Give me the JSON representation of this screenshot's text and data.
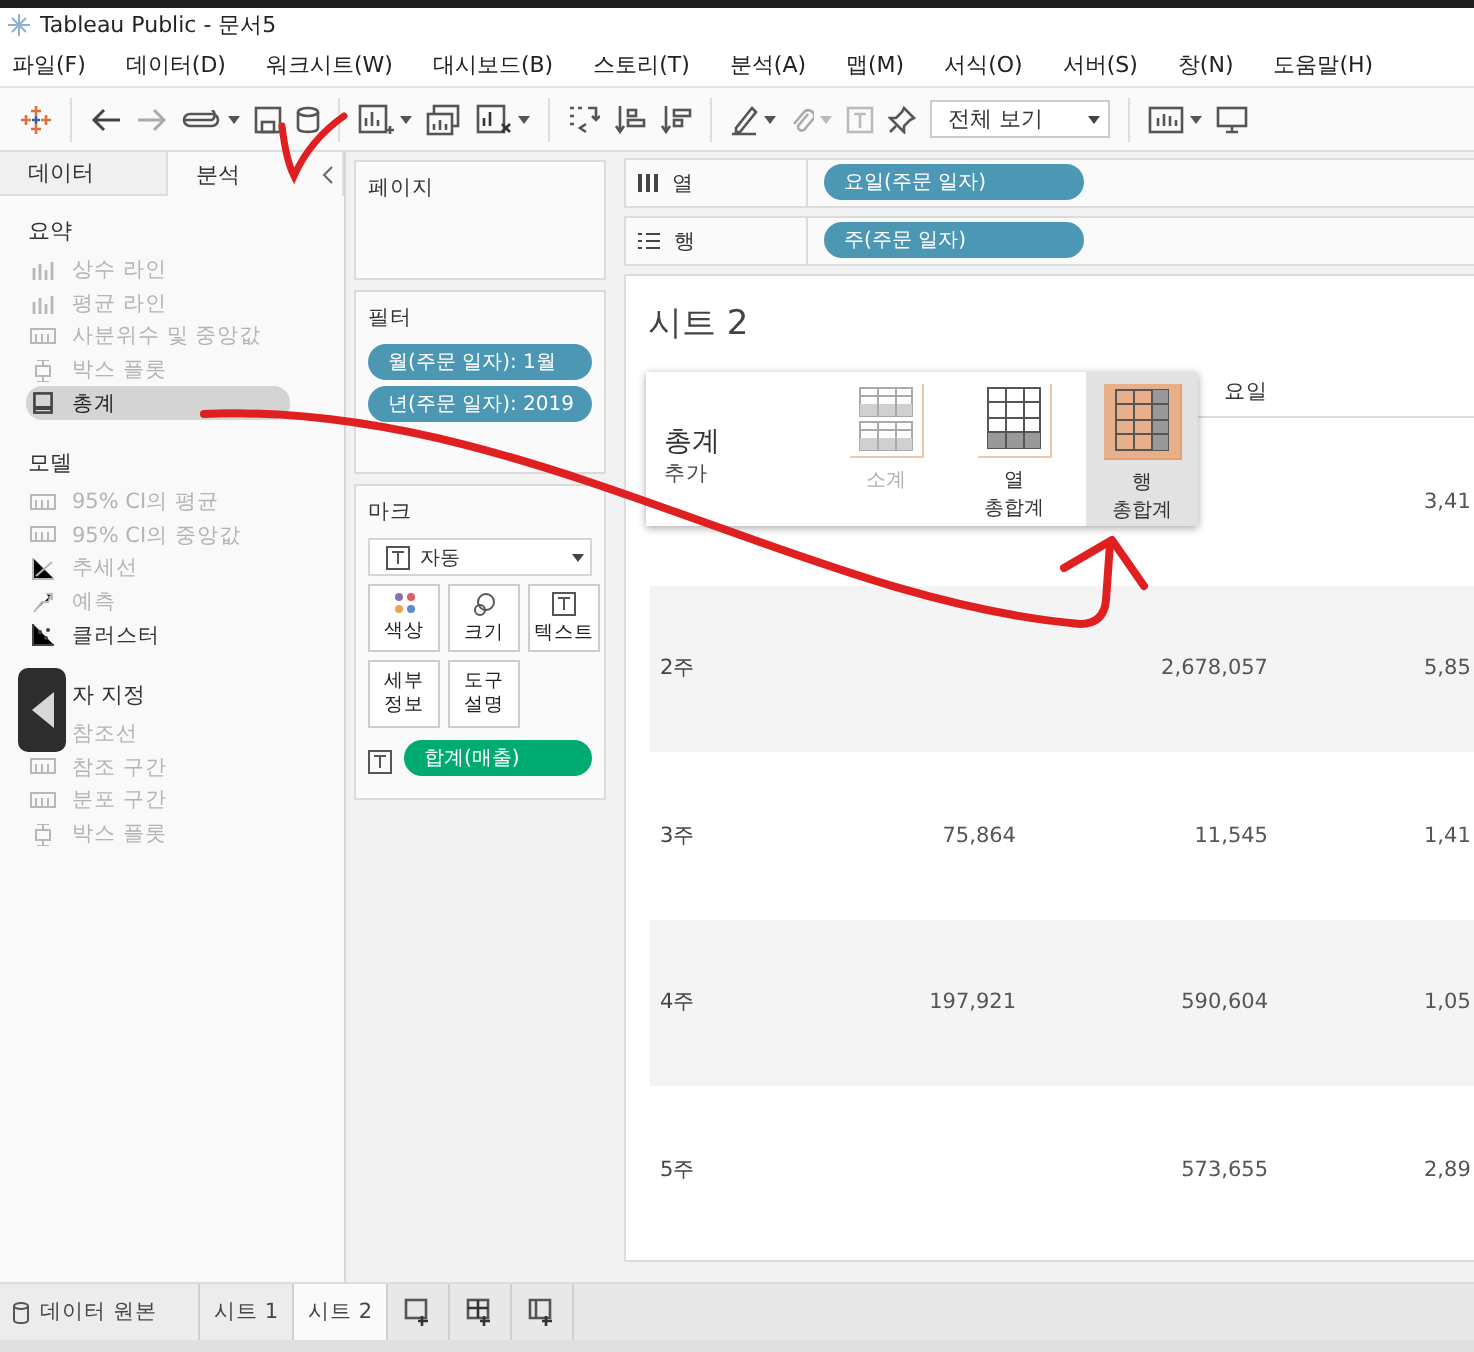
{
  "window": {
    "title": "Tableau Public - 문서5"
  },
  "menu": [
    "파일(F)",
    "데이터(D)",
    "워크시트(W)",
    "대시보드(B)",
    "스토리(T)",
    "분석(A)",
    "맵(M)",
    "서식(O)",
    "서버(S)",
    "창(N)",
    "도움말(H)"
  ],
  "toolbar": {
    "fit_dropdown": "전체 보기"
  },
  "left_pane": {
    "tabs": [
      {
        "label": "데이터",
        "selected": false
      },
      {
        "label": "분석",
        "selected": true
      }
    ],
    "sections": [
      {
        "title": "요약",
        "items": [
          {
            "kind": "bars",
            "label": "상수 라인",
            "disabled": true,
            "selected": false
          },
          {
            "kind": "bars",
            "label": "평균 라인",
            "disabled": true,
            "selected": false
          },
          {
            "kind": "band",
            "label": "사분위수 및 중앙값",
            "disabled": true,
            "selected": false
          },
          {
            "kind": "box",
            "label": "박스 플롯",
            "disabled": true,
            "selected": false
          },
          {
            "kind": "total",
            "label": "총계",
            "disabled": false,
            "selected": true
          }
        ]
      },
      {
        "title": "모델",
        "items": [
          {
            "kind": "band",
            "label": "95% CI의 평균",
            "disabled": true,
            "selected": false
          },
          {
            "kind": "band",
            "label": "95% CI의 중앙값",
            "disabled": true,
            "selected": false
          },
          {
            "kind": "trend",
            "label": "추세선",
            "disabled": true,
            "selected": false
          },
          {
            "kind": "forecast",
            "label": "예측",
            "disabled": true,
            "selected": false
          },
          {
            "kind": "cluster",
            "label": "클러스터",
            "disabled": false,
            "selected": false
          }
        ]
      },
      {
        "title": "자 지정",
        "items": [
          {
            "kind": "hidden",
            "label": "참조선",
            "disabled": true,
            "selected": false
          },
          {
            "kind": "band",
            "label": "참조 구간",
            "disabled": true,
            "selected": false
          },
          {
            "kind": "band",
            "label": "분포 구간",
            "disabled": true,
            "selected": false
          },
          {
            "kind": "box",
            "label": "박스 플롯",
            "disabled": true,
            "selected": false
          }
        ]
      }
    ]
  },
  "cards": {
    "pages": "페이지",
    "filters": {
      "title": "필터",
      "pills": [
        "월(주문 일자): 1월",
        "년(주문 일자): 2019"
      ]
    },
    "marks": {
      "title": "마크",
      "type": "자동",
      "buttons": [
        {
          "kind": "color",
          "label": "색상"
        },
        {
          "kind": "size",
          "label": "크기"
        },
        {
          "kind": "text",
          "label": "텍스트"
        },
        {
          "kind": "plain",
          "label": "세부\n정보"
        },
        {
          "kind": "plain",
          "label": "도구\n설명"
        }
      ],
      "pill": "합계(매출)"
    }
  },
  "shelves": [
    {
      "kind": "columns",
      "label": "열",
      "pill": "요일(주문 일자)"
    },
    {
      "kind": "rows",
      "label": "행",
      "pill": "주(주문 일자)"
    }
  ],
  "sheet": {
    "title": "시트 2",
    "header": "요일",
    "rows": [
      {
        "label": null,
        "cells": [
          null,
          null,
          "3,41"
        ]
      },
      {
        "label": "2주",
        "cells": [
          null,
          "2,678,057",
          "5,85"
        ]
      },
      {
        "label": "3주",
        "cells": [
          "75,864",
          "11,545",
          "1,41"
        ]
      },
      {
        "label": "4주",
        "cells": [
          "197,921",
          "590,604",
          "1,05"
        ]
      },
      {
        "label": "5주",
        "cells": [
          null,
          "573,655",
          "2,89"
        ]
      }
    ]
  },
  "totals_popup": {
    "title": "총계",
    "subtitle": "추가",
    "options": [
      {
        "kind": "subtotal",
        "label": "소계",
        "disabled": true,
        "selected": false
      },
      {
        "kind": "column",
        "label": "열\n총합계",
        "disabled": false,
        "selected": false
      },
      {
        "kind": "row",
        "label": "행\n총합계",
        "disabled": false,
        "selected": true
      }
    ]
  },
  "bottom_tabs": [
    {
      "kind": "datasource",
      "label": "데이터 원본",
      "selected": false
    },
    {
      "kind": "sheet",
      "label": "시트 1",
      "selected": false
    },
    {
      "kind": "sheet",
      "label": "시트 2",
      "selected": true
    }
  ]
}
